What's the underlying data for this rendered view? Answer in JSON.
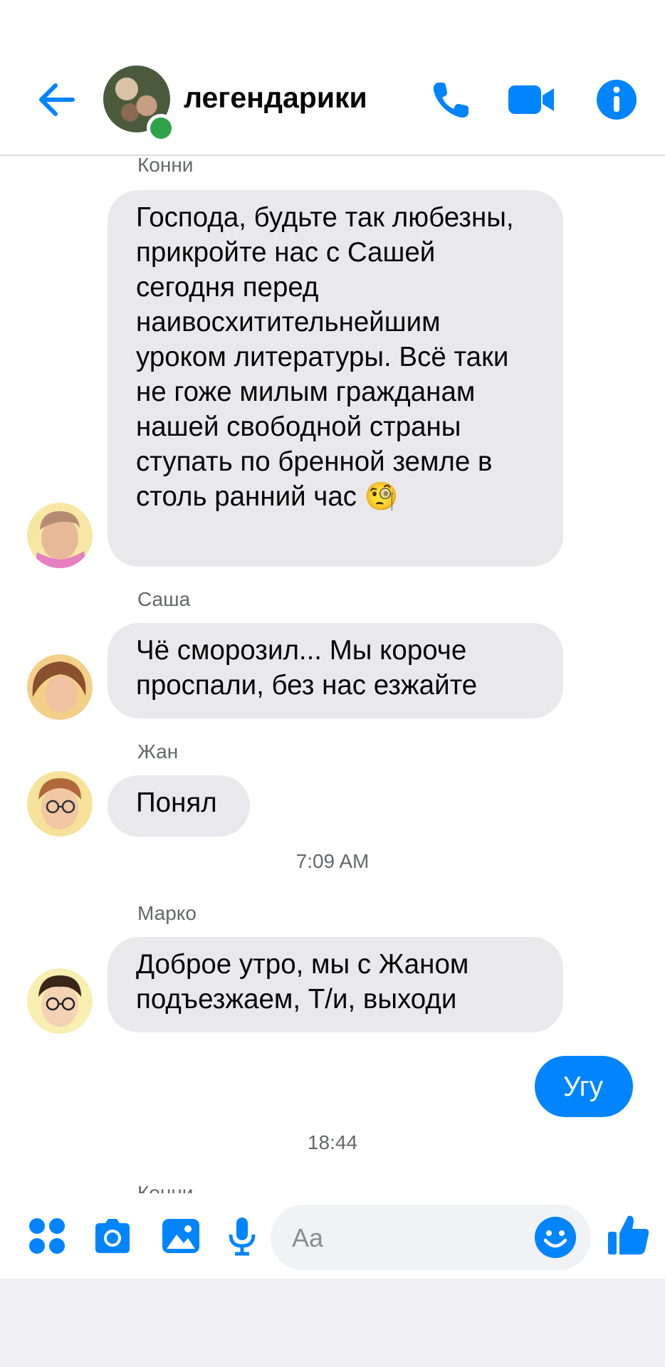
{
  "header": {
    "title": "легендарики",
    "accent": "#0084ff",
    "online_color": "#31a24c"
  },
  "messages": [
    {
      "sender": "Конни",
      "text": "Господа, будьте так любезны, прикройте нас с Сашей сегодня перед наивосхитительнейшим уроком литературы. Всё таки не гоже милым гражданам нашей свободной страны ступать по бренной земле в столь ранний час 🧐"
    },
    {
      "sender": "Саша",
      "text": "Чё сморозил... Мы короче проспали, без нас езжайте"
    },
    {
      "sender": "Жан",
      "text": "Понял"
    },
    {
      "timestamp": "7:09 AM"
    },
    {
      "sender": "Марко",
      "text": "Доброе утро, мы с Жаном подъезжаем, Т/и, выходи"
    },
    {
      "own_text": "Угу"
    },
    {
      "timestamp": "18:44"
    },
    {
      "sender_partial": "Конни"
    }
  ],
  "composer": {
    "placeholder": "Aa",
    "icons": [
      "apps-icon",
      "camera-icon",
      "gallery-icon",
      "microphone-icon",
      "emoji-icon",
      "thumbs-up-icon"
    ]
  }
}
